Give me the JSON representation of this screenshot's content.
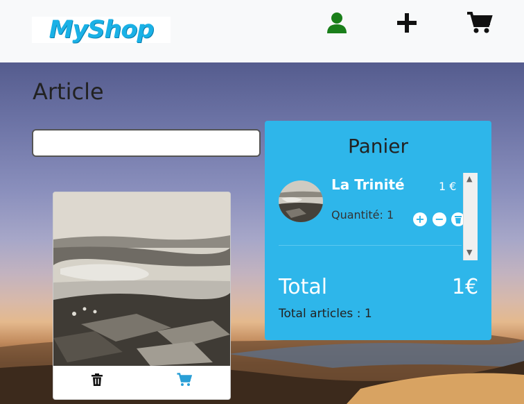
{
  "brand": {
    "name": "MyShop",
    "color": "#1ab1e6"
  },
  "nav": {
    "icons": [
      "user-icon",
      "plus-icon",
      "cart-icon"
    ],
    "user_icon_color": "#1a7f1a"
  },
  "page": {
    "title": "Article"
  },
  "search": {
    "value": "",
    "placeholder": ""
  },
  "products": [
    {
      "image": "aerial-photo",
      "actions": [
        "trash-icon",
        "cart-icon"
      ]
    }
  ],
  "cart": {
    "title": "Panier",
    "items": [
      {
        "name": "La Trinité",
        "price": "1 €",
        "quantity_label": "Quantité: 1"
      }
    ],
    "total_label": "Total",
    "total_value": "1€",
    "total_articles": "Total articles : 1"
  }
}
